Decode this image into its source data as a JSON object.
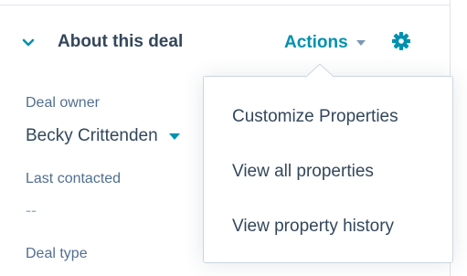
{
  "section": {
    "title": "About this deal",
    "actions_label": "Actions",
    "accent_color": "#0091ae",
    "collapse_icon": "chevron-down-icon",
    "settings_icon": "gear-icon"
  },
  "fields": {
    "owner": {
      "label": "Deal owner",
      "value": "Becky Crittenden"
    },
    "last_contacted": {
      "label": "Last contacted",
      "value": "--"
    },
    "deal_type": {
      "label": "Deal type"
    }
  },
  "actions_menu": {
    "items": [
      {
        "label": "Customize Properties"
      },
      {
        "label": "View all properties"
      },
      {
        "label": "View property history"
      }
    ]
  }
}
